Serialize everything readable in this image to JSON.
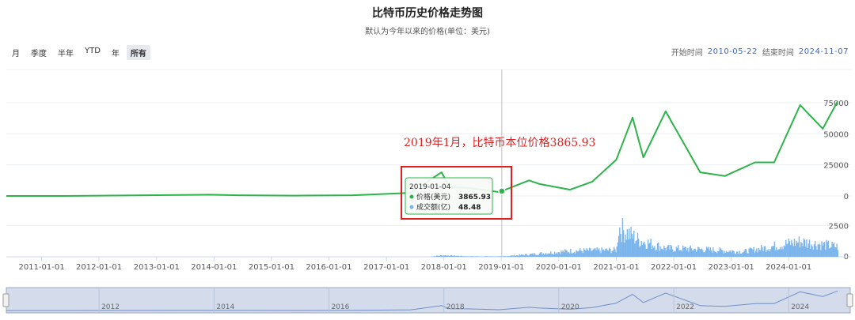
{
  "title": "比特币历史价格走势图",
  "subtitle": "默认为今年以来的价格(单位：美元)",
  "range_buttons": [
    "月",
    "季度",
    "半年",
    "YTD",
    "年",
    "所有"
  ],
  "active_range": "所有",
  "date_range": {
    "start_label": "开始时间",
    "start_value": "2010-05-22",
    "end_label": "结束时间",
    "end_value": "2024-11-07"
  },
  "annotation": "2019年1月，比特币本位价格3865.93",
  "tooltip": {
    "date": "2019-01-04",
    "price_label": "价格(美元)",
    "price_value": "3865.93",
    "volume_label": "成交额(亿)",
    "volume_value": "48.48"
  },
  "colors": {
    "price_line": "#2db34a",
    "volume": "#7cb5ec",
    "annotation": "#e02020",
    "navigator_fill": "#d4dcec"
  },
  "chart_data": {
    "type": "line",
    "x_is_date": true,
    "price_axis_ticks": [
      0,
      25000,
      50000,
      75000
    ],
    "volume_axis_ticks": [
      0,
      2500
    ],
    "x_tick_labels": [
      "2011-01-01",
      "2012-01-01",
      "2013-01-01",
      "2014-01-01",
      "2015-01-01",
      "2016-01-01",
      "2017-01-01",
      "2018-01-01",
      "2019-01-01",
      "2020-01-01",
      "2021-01-01",
      "2022-01-01",
      "2023-01-01",
      "2024-01-01"
    ],
    "navigator_labels": [
      "2012",
      "2014",
      "2016",
      "2018",
      "2020",
      "2022",
      "2024"
    ],
    "series": [
      {
        "name": "价格(美元)",
        "points": [
          [
            "2010-05-22",
            0
          ],
          [
            "2011-06-01",
            20
          ],
          [
            "2013-12-01",
            1000
          ],
          [
            "2014-06-01",
            600
          ],
          [
            "2015-06-01",
            250
          ],
          [
            "2016-06-01",
            600
          ],
          [
            "2017-06-01",
            2500
          ],
          [
            "2017-12-17",
            19000
          ],
          [
            "2018-02-06",
            7000
          ],
          [
            "2018-06-01",
            6500
          ],
          [
            "2018-12-15",
            3200
          ],
          [
            "2019-01-04",
            3865.93
          ],
          [
            "2019-06-26",
            12500
          ],
          [
            "2019-09-01",
            9600
          ],
          [
            "2020-03-13",
            5000
          ],
          [
            "2020-08-01",
            11500
          ],
          [
            "2020-12-31",
            29000
          ],
          [
            "2021-04-14",
            63000
          ],
          [
            "2021-06-22",
            31000
          ],
          [
            "2021-11-10",
            68000
          ],
          [
            "2022-06-18",
            19000
          ],
          [
            "2022-11-21",
            16000
          ],
          [
            "2023-06-01",
            27000
          ],
          [
            "2023-10-01",
            27000
          ],
          [
            "2024-03-14",
            73000
          ],
          [
            "2024-08-05",
            54000
          ],
          [
            "2024-11-07",
            76000
          ]
        ]
      },
      {
        "name": "成交额(亿)",
        "points": [
          [
            "2017-10-01",
            20
          ],
          [
            "2017-12-20",
            180
          ],
          [
            "2018-06-01",
            60
          ],
          [
            "2019-01-04",
            48.48
          ],
          [
            "2019-06-01",
            250
          ],
          [
            "2020-03-13",
            700
          ],
          [
            "2020-12-31",
            800
          ],
          [
            "2021-01-11",
            3500
          ],
          [
            "2021-05-19",
            2000
          ],
          [
            "2021-11-10",
            1000
          ],
          [
            "2022-06-13",
            900
          ],
          [
            "2023-03-13",
            600
          ],
          [
            "2024-03-05",
            1800
          ],
          [
            "2024-11-07",
            1200
          ]
        ]
      }
    ],
    "price_ylim": [
      0,
      80000
    ],
    "volume_ylim": [
      0,
      4000
    ]
  }
}
